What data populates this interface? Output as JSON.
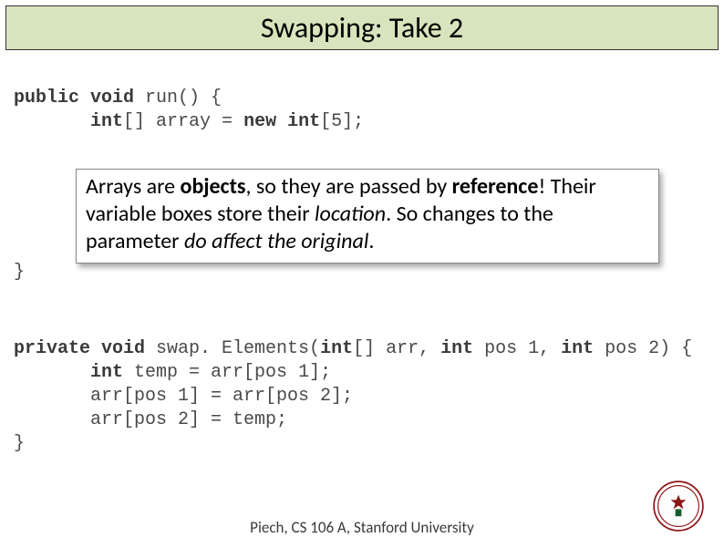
{
  "title": "Swapping: Take 2",
  "code1": {
    "line1_pre": "public void",
    "line1_post": " run() {",
    "line2_pre": "int",
    "line2_mid": "[] array = ",
    "line2_kw": "new int",
    "line2_post": "[5];"
  },
  "brace_close": "}",
  "callout": {
    "t1": "Arrays are ",
    "t2": "objects",
    "t3": ", so they are passed by ",
    "t4": "reference",
    "t5": "!  Their variable boxes store their ",
    "t6": "location",
    "t7": ".  So changes to the parameter ",
    "t8": "do affect",
    "t9": " ",
    "t10": "the original",
    "t11": "."
  },
  "code2": {
    "l1_pre": "private void",
    "l1_mid": " swap. Elements(",
    "l1_kw2": "int",
    "l1_mid2": "[] arr, ",
    "l1_kw3": "int",
    "l1_mid3": " pos 1, ",
    "l1_kw4": "int",
    "l1_post": " pos 2) {",
    "l2_kw": "int",
    "l2_post": " temp = arr[pos 1];",
    "l3": "arr[pos 1] = arr[pos 2];",
    "l4": "arr[pos 2] = temp;",
    "l5": "}"
  },
  "footer": "Piech, CS 106 A, Stanford University"
}
